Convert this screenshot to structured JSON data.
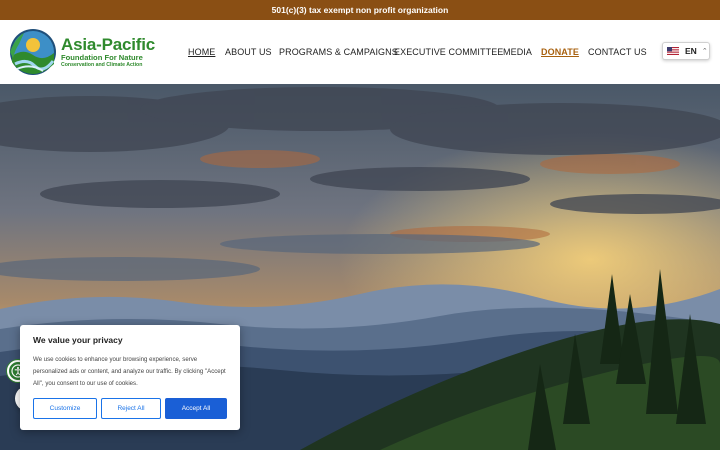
{
  "topbar": {
    "text": "501(c)(3) tax exempt non profit organization"
  },
  "logo": {
    "title": "Asia-Pacific",
    "subtitle": "Foundation For Nature",
    "tagline": "Conservation and Climate Action"
  },
  "nav": {
    "items": [
      {
        "label": "HOME"
      },
      {
        "label": "ABOUT US"
      },
      {
        "label": "PROGRAMS & CAMPAIGNS"
      },
      {
        "label": "EXECUTIVE COMMITTEE"
      },
      {
        "label": "MEDIA"
      },
      {
        "label": "DONATE"
      },
      {
        "label": "CONTACT US"
      }
    ],
    "active": "HOME"
  },
  "language": {
    "label": "EN",
    "flag_icon": "us-flag-icon"
  },
  "cookie_banner": {
    "title": "We value your privacy",
    "body": "We use cookies to enhance your browsing experience, serve personalized ads or content, and analyze our traffic. By clicking \"Accept All\", you consent to our use of cookies.",
    "customize": "Customize",
    "reject": "Reject All",
    "accept": "Accept All"
  },
  "colors": {
    "topbar": "#8a4f14",
    "brand_green": "#2f8a2d",
    "donate": "#a8610f",
    "accent_blue": "#1a5fd6"
  }
}
